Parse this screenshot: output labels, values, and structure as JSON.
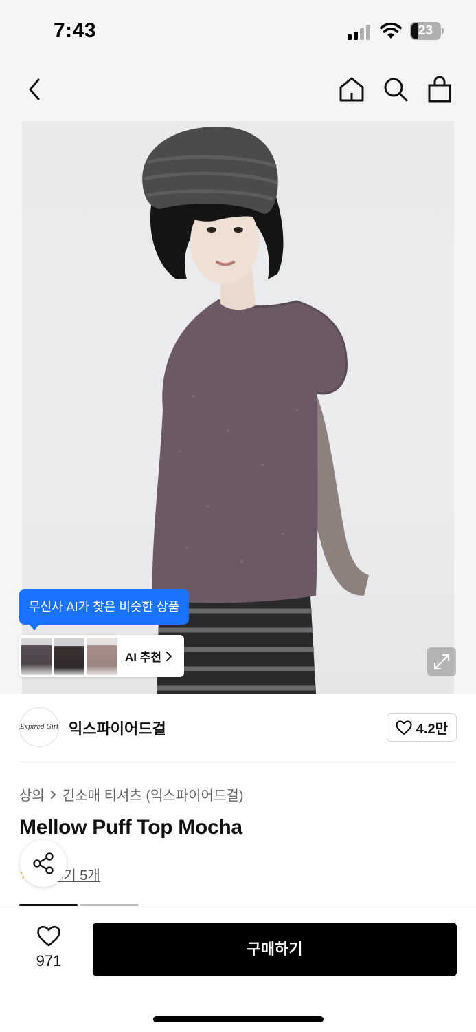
{
  "status_bar": {
    "time": "7:43",
    "battery": "23"
  },
  "nav": {
    "back": "back",
    "home": "home",
    "search": "search",
    "cart": "shopping-bag"
  },
  "hero": {
    "ai_tooltip": "무신사 AI가 찾은 비슷한 상품",
    "ai_card_label": "AI 추천"
  },
  "brand": {
    "logo_text": "Expired Girl",
    "name": "익스파이어드걸",
    "likes": "4.2만"
  },
  "breadcrumb": {
    "category": "상의",
    "subcategory": "긴소매 티셔츠 (익스파이어드걸)"
  },
  "product": {
    "title": "Mellow Puff Top Mocha",
    "review_text": "후기 5개"
  },
  "bottom": {
    "wish_count": "971",
    "buy_label": "구매하기"
  },
  "colors": {
    "accent_blue": "#1a73ff",
    "buy_bg": "#000000",
    "star": "#f2b400"
  }
}
